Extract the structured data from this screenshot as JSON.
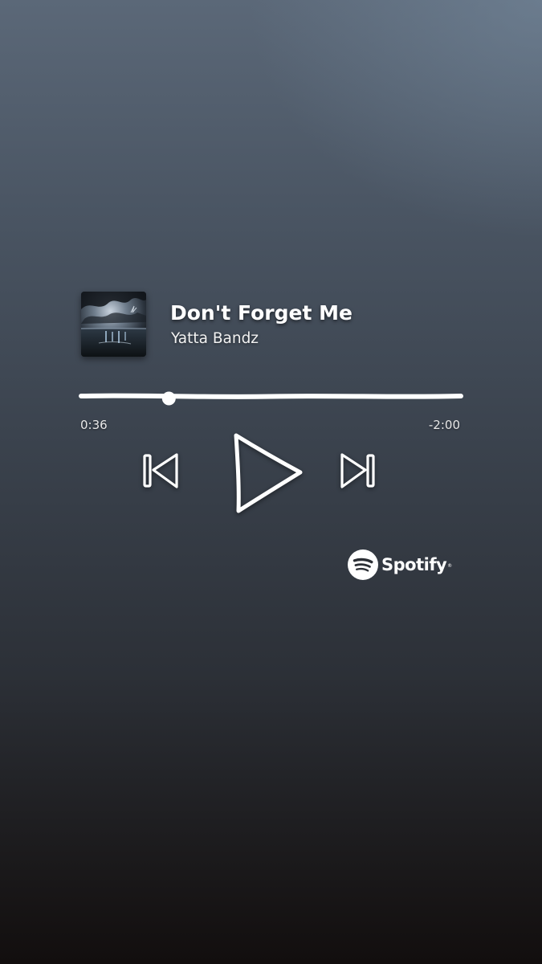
{
  "track": {
    "title": "Don't Forget Me",
    "artist": "Yatta Bandz"
  },
  "playback": {
    "elapsed": "0:36",
    "remaining": "-2:00",
    "progress_fraction": 0.231,
    "state": "paused"
  },
  "controls": {
    "previous_icon": "skip-previous-icon",
    "play_icon": "play-icon",
    "next_icon": "skip-next-icon"
  },
  "branding": {
    "logo_icon": "spotify-logo-icon",
    "name": "Spotify",
    "registered_mark": "®"
  },
  "colors": {
    "foreground": "#ffffff",
    "background_top": "#5b6878",
    "background_bottom": "#120e0e"
  }
}
